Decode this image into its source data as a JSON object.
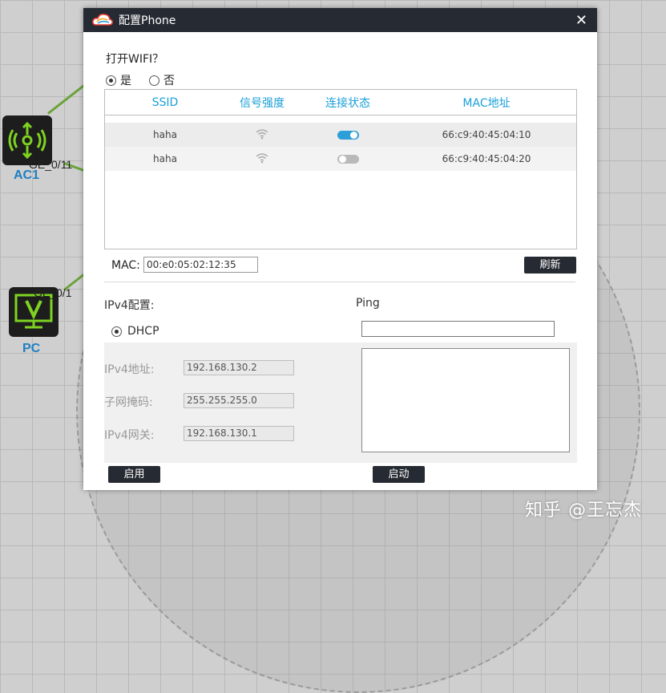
{
  "topology": {
    "ac1_label": "AC1",
    "ac1_port": "GE_0/11",
    "pc_label": "PC",
    "pc_port": "GE_0/1"
  },
  "watermark": "知乎 @王忘杰",
  "dialog": {
    "title": "配置Phone",
    "icon": "cloud-logo-icon",
    "close_label": "✕",
    "wifi_question": "打开WIFI？",
    "wifi_options": {
      "yes": "是",
      "no": "否",
      "selected": "yes"
    },
    "table": {
      "headers": [
        "SSID",
        "信号强度",
        "连接状态",
        "MAC地址"
      ],
      "rows": [
        {
          "ssid": "haha",
          "signal_icon": "wifi-signal-icon",
          "connected": true,
          "mac": "66:c9:40:45:04:10"
        },
        {
          "ssid": "haha",
          "signal_icon": "wifi-signal-icon",
          "connected": false,
          "mac": "66:c9:40:45:04:20"
        }
      ]
    },
    "mac_label": "MAC:",
    "mac_value": "00:e0:05:02:12:35",
    "refresh_label": "刷新",
    "ipv4_title": "IPv4配置:",
    "dhcp_label": "DHCP",
    "ipv4_address_label": "IPv4地址:",
    "ipv4_address": "192.168.130.2",
    "subnet_label": "子网掩码:",
    "subnet": "255.255.255.0",
    "gateway_label": "IPv4网关:",
    "gateway": "192.168.130.1",
    "apply_label": "启用",
    "ping_title": "Ping",
    "ping_input": "",
    "start_label": "启动"
  },
  "colors": {
    "title_bar": "#262a32",
    "accent": "#1aa0d8",
    "toggle_on": "#2d9fd8",
    "link": "#6aa33a",
    "device_label": "#1f7fc2"
  }
}
